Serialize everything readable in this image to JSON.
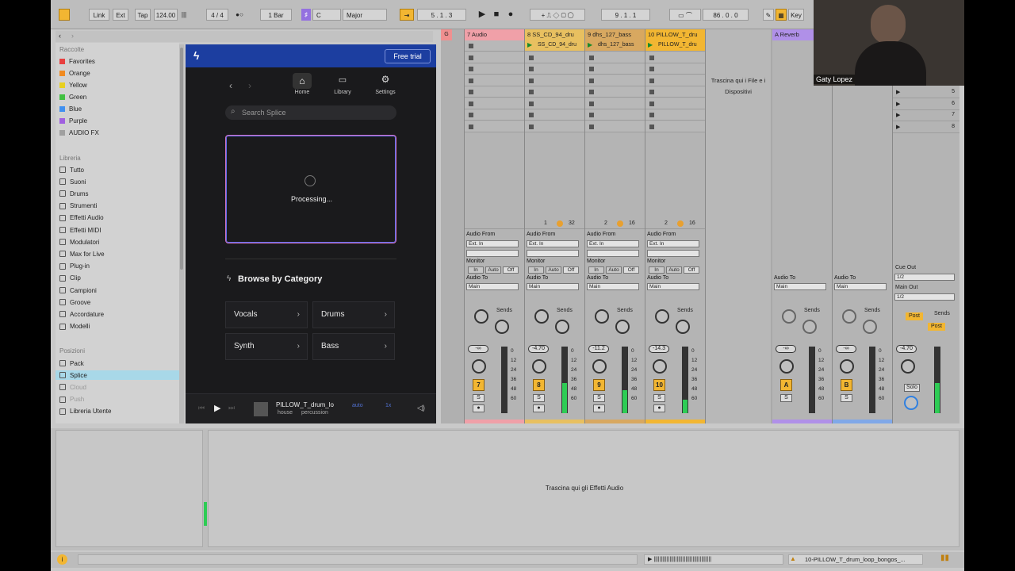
{
  "transport": {
    "link": "Link",
    "ext": "Ext",
    "tap": "Tap",
    "tempo": "124.00",
    "meter": "4 / 4",
    "quantize": "1 Bar",
    "key": "C",
    "scale": "Major",
    "position": "5 . 1 . 3",
    "loop_start": "9 . 1 . 1",
    "loop_length": "86 . 0 . 0",
    "key_label": "Key"
  },
  "browser": {
    "collections_title": "Raccolte",
    "collections": [
      {
        "label": "Favorites",
        "color": "#e84040"
      },
      {
        "label": "Orange",
        "color": "#f08a20"
      },
      {
        "label": "Yellow",
        "color": "#e8d020"
      },
      {
        "label": "Green",
        "color": "#40c040"
      },
      {
        "label": "Blue",
        "color": "#4090f0"
      },
      {
        "label": "Purple",
        "color": "#a060e0"
      },
      {
        "label": "AUDIO FX",
        "color": "#a0a0a0"
      }
    ],
    "library_title": "Libreria",
    "library": [
      "Tutto",
      "Suoni",
      "Drums",
      "Strumenti",
      "Effetti Audio",
      "Effetti MIDI",
      "Modulatori",
      "Max for Live",
      "Plug-in",
      "Clip",
      "Campioni",
      "Groove",
      "Accordature",
      "Modelli"
    ],
    "places_title": "Posizioni",
    "places": [
      "Pack",
      "Splice",
      "Cloud",
      "Push",
      "Libreria Utente"
    ]
  },
  "splice": {
    "free_trial": "Free trial",
    "nav": {
      "home": "Home",
      "library": "Library",
      "settings": "Settings"
    },
    "search_placeholder": "Search Splice",
    "processing": "Processing...",
    "browse_title": "Browse by Category",
    "categories": [
      "Vocals",
      "Drums",
      "Synth",
      "Bass"
    ],
    "player": {
      "title": "PILLOW_T_drum_lo",
      "tag1": "house",
      "tag2": "percussion",
      "key": "auto",
      "bpm": "1x"
    }
  },
  "session": {
    "drop_hint": "Trascina qui i File e i Dispositivi",
    "tracks": [
      {
        "name": "7 Audio",
        "color": "#f0a0a8",
        "clip": "",
        "num": "7",
        "vol": "-∞",
        "meter": 0
      },
      {
        "name": "8 SS_CD_94_dru",
        "color": "#e8c060",
        "clip": "SS_CD_94_dru",
        "num": "8",
        "vol": "-4.70",
        "meter": 0.45
      },
      {
        "name": "9 dhs_127_bass",
        "color": "#d8a860",
        "clip": "dhs_127_bass",
        "num": "9",
        "vol": "-11.2",
        "meter": 0.35
      },
      {
        "name": "10 PILLOW_T_dru",
        "color": "#f2b632",
        "clip": "PILLOW_T_dru",
        "num": "10",
        "vol": "-14.3",
        "meter": 0.2
      }
    ],
    "returns": [
      {
        "name": "A Reverb",
        "color": "#b090e8",
        "letter": "A",
        "vol": "-∞"
      },
      {
        "name": "B",
        "color": "#80a8e8",
        "letter": "B",
        "vol": "-∞"
      }
    ],
    "master": {
      "vol": "-4.70",
      "cue_out": "Cue Out",
      "cue_val": "1/2",
      "main_out": "Main Out",
      "main_val": "1/2",
      "solo": "Solo",
      "post": "Post",
      "scenes": [
        "5",
        "6",
        "7",
        "8"
      ]
    },
    "labels": {
      "audio_from": "Audio From",
      "ext_in": "Ext. In",
      "monitor": "Monitor",
      "in": "In",
      "auto": "Auto",
      "off": "Off",
      "audio_to": "Audio To",
      "main": "Main",
      "sends": "Sends",
      "s": "S"
    },
    "slot_counts": [
      {
        "a": "1",
        "b": "32"
      },
      {
        "a": "2",
        "b": "16"
      },
      {
        "a": "2",
        "b": "16"
      }
    ]
  },
  "device": {
    "drop_hint": "Trascina qui gli Effetti Audio"
  },
  "status": {
    "clip_name": "10-PILLOW_T_drum_loop_bongos_..."
  },
  "webcam": {
    "name": "Gaty Lopez"
  }
}
